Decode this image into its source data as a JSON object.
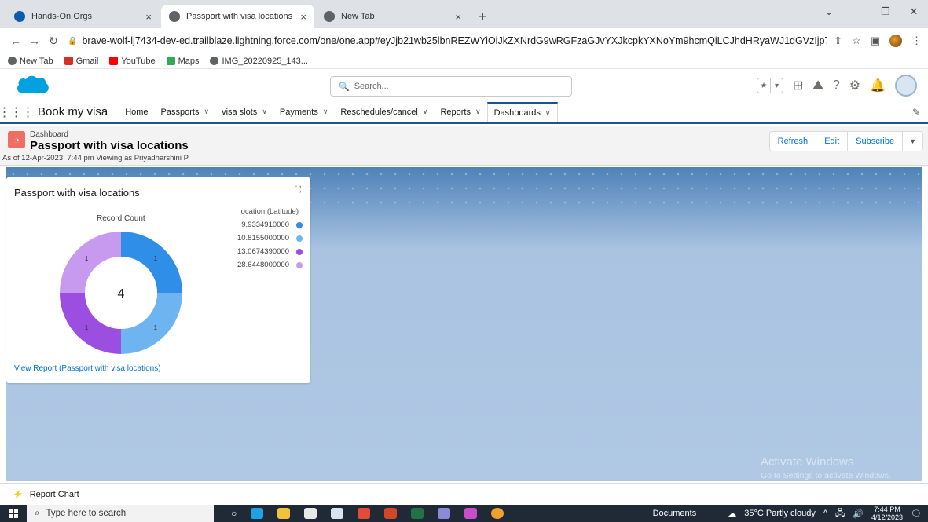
{
  "browser": {
    "tabs": [
      {
        "title": "Hands-On Orgs",
        "active": false,
        "icon": "trailhead-icon"
      },
      {
        "title": "Passport with visa locations | Sale",
        "active": true,
        "icon": "globe-icon"
      },
      {
        "title": "New Tab",
        "active": false,
        "icon": "chrome-icon"
      }
    ],
    "url": "brave-wolf-lj7434-dev-ed.trailblaze.lightning.force.com/one/one.app#eyJjb21wb25lbnREZWYiOiJkZXNrdG9wRGFzaGJvYXJkcpkYXNoYm9hcmQiLCJhdHRyaWJ1dGVzIjp7ImRhc2hib2FyZElkIjoiMDFa...",
    "bookmarks": [
      "New Tab",
      "Gmail",
      "YouTube",
      "Maps",
      "IMG_20220925_143..."
    ]
  },
  "sf_header": {
    "search_placeholder": "Search..."
  },
  "app_nav": {
    "app_name": "Book my visa",
    "items": [
      {
        "label": "Home",
        "has_menu": false
      },
      {
        "label": "Passports",
        "has_menu": true
      },
      {
        "label": "visa slots",
        "has_menu": true
      },
      {
        "label": "Payments",
        "has_menu": true
      },
      {
        "label": "Reschedules/cancel",
        "has_menu": true
      },
      {
        "label": "Reports",
        "has_menu": true
      },
      {
        "label": "Dashboards",
        "has_menu": true,
        "active": true
      }
    ]
  },
  "dashboard": {
    "type_label": "Dashboard",
    "title": "Passport with visa locations",
    "meta": "As of 12-Apr-2023, 7:44 pm Viewing as Priyadharshini P",
    "buttons": {
      "refresh": "Refresh",
      "edit": "Edit",
      "subscribe": "Subscribe"
    }
  },
  "widget": {
    "title": "Passport with visa locations",
    "subtitle": "Record Count",
    "legend_title": "location (Latitude)",
    "center_total": "4",
    "link": "View Report (Passport with visa locations)"
  },
  "chart_data": {
    "type": "pie",
    "title": "Record Count",
    "legend_title": "location (Latitude)",
    "legend_placement": "right",
    "total": 4,
    "categories": [
      "9.9334910000",
      "10.8155000000",
      "13.0674390000",
      "28.6448000000"
    ],
    "values": [
      1,
      1,
      1,
      1
    ],
    "colors": [
      "#2e8ee8",
      "#6db4f0",
      "#9b4ee0",
      "#c79af0"
    ]
  },
  "watermark": {
    "line1": "Activate Windows",
    "line2": "Go to Settings to activate Windows."
  },
  "utility_bar": {
    "item": "Report Chart"
  },
  "taskbar": {
    "search_placeholder": "Type here to search",
    "documents": "Documents",
    "weather": "35°C  Partly cloudy",
    "time": "7:44 PM",
    "date": "4/12/2023"
  }
}
